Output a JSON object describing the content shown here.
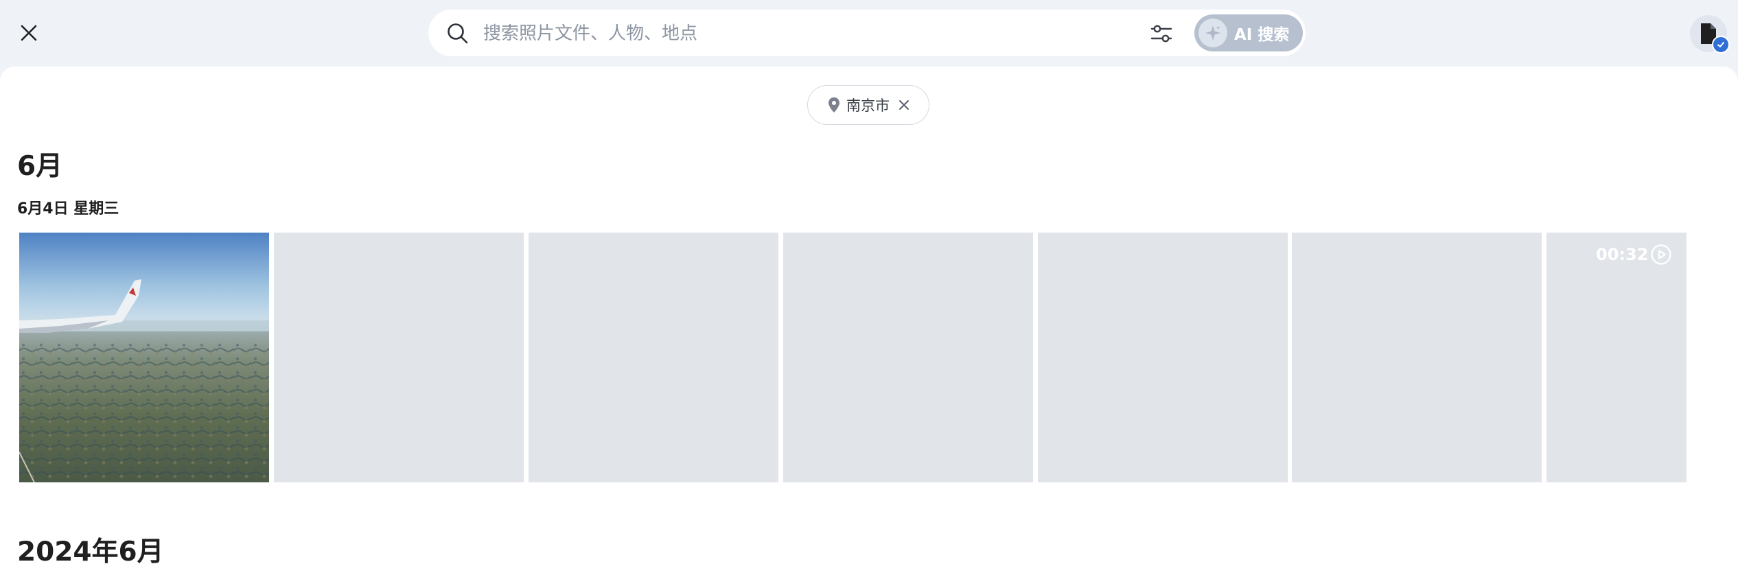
{
  "search": {
    "placeholder": "搜索照片文件、人物、地点",
    "ai_label": "AI 搜索"
  },
  "filter_chip": {
    "icon": "location-pin-icon",
    "label": "南京市"
  },
  "sections": [
    {
      "month": "6月",
      "day": "6月4日 星期三",
      "video_duration": "00:32"
    },
    {
      "month": "2024年6月"
    }
  ],
  "colors": {
    "topbar_bg": "#eff3f8",
    "ai_button_bg": "#b6c0cf",
    "placeholder_tile": "#e1e4e9",
    "badge_blue": "#2f6fd6"
  }
}
